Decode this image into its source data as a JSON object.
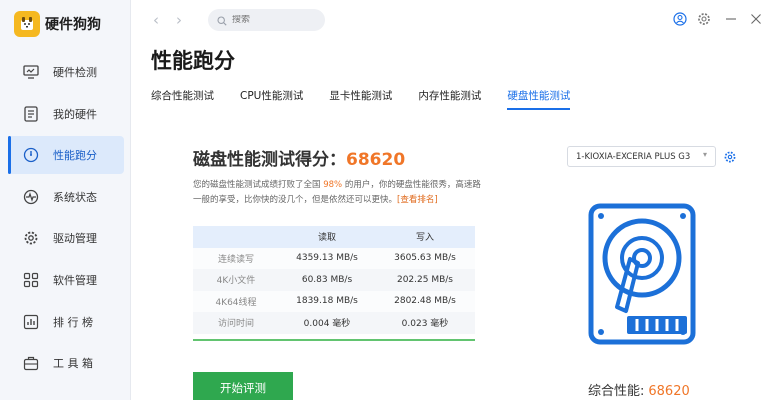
{
  "app": {
    "name": "硬件狗狗"
  },
  "sidebar": {
    "items": [
      {
        "label": "硬件检测",
        "icon": "monitor-icon"
      },
      {
        "label": "我的硬件",
        "icon": "list-icon"
      },
      {
        "label": "性能跑分",
        "icon": "speedometer-icon",
        "active": true
      },
      {
        "label": "系统状态",
        "icon": "pulse-icon"
      },
      {
        "label": "驱动管理",
        "icon": "gear-icon"
      },
      {
        "label": "软件管理",
        "icon": "apps-icon"
      },
      {
        "label": "排 行 榜",
        "icon": "ranking-icon"
      },
      {
        "label": "工 具 箱",
        "icon": "toolbox-icon"
      }
    ]
  },
  "topbar": {
    "search_placeholder": "搜索"
  },
  "page": {
    "title": "性能跑分",
    "tabs": [
      "综合性能测试",
      "CPU性能测试",
      "显卡性能测试",
      "内存性能测试",
      "硬盘性能测试"
    ],
    "active_tab": 4
  },
  "disk_test": {
    "heading": "磁盘性能测试得分：",
    "score": "68620",
    "desc_prefix": "您的磁盘性能测试成绩打败了全国 ",
    "percent": "98%",
    "desc_mid": " 的用户，你的硬盘性能很秀，高速路一般的享受，比你快的没几个，但是依然还可以更快。",
    "rank_link": "[查看排名]",
    "table": {
      "headers": [
        "",
        "读取",
        "写入"
      ],
      "rows": [
        [
          "连续读写",
          "4359.13 MB/s",
          "3605.63 MB/s"
        ],
        [
          "4K小文件",
          "60.83 MB/s",
          "202.25 MB/s"
        ],
        [
          "4K64线程",
          "1839.18 MB/s",
          "2802.48 MB/s"
        ],
        [
          "访问时间",
          "0.004 毫秒",
          "0.023 毫秒"
        ]
      ]
    },
    "start_button": "开始评测",
    "device": "1-KIOXIA-EXCERIA PLUS G3",
    "summary_label": "综合性能:",
    "summary_value": "68620"
  },
  "colors": {
    "accent": "#1a6fe8",
    "score": "#f07628",
    "start_button": "#2fa84f",
    "table_line": "#62c470"
  }
}
